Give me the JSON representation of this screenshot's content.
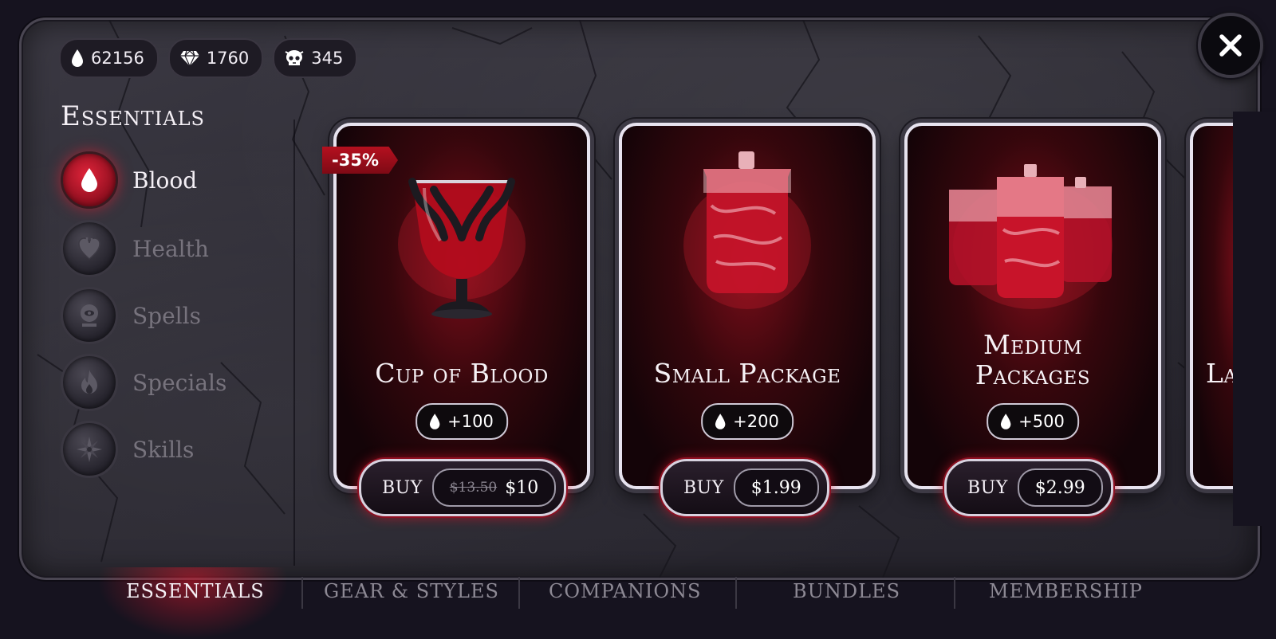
{
  "currency": [
    {
      "icon": "blood-drop-icon",
      "value": "62156"
    },
    {
      "icon": "diamond-icon",
      "value": "1760"
    },
    {
      "icon": "skull-icon",
      "value": "345"
    }
  ],
  "sidebar": {
    "title": "Essentials",
    "items": [
      {
        "label": "Blood",
        "icon": "blood-drop-icon",
        "active": true
      },
      {
        "label": "Health",
        "icon": "heart-icon",
        "active": false
      },
      {
        "label": "Spells",
        "icon": "crystal-ball-icon",
        "active": false
      },
      {
        "label": "Specials",
        "icon": "flame-icon",
        "active": false
      },
      {
        "label": "Skills",
        "icon": "compass-star-icon",
        "active": false
      }
    ]
  },
  "products": [
    {
      "title": "Cup of Blood",
      "reward": "+100",
      "buy_label": "BUY",
      "old_price": "$13.50",
      "price": "$10",
      "badge": "-35%"
    },
    {
      "title": "Small Package",
      "reward": "+200",
      "buy_label": "BUY",
      "price": "$1.99"
    },
    {
      "title_line1": "Medium",
      "title_line2": "Packages",
      "reward": "+500",
      "buy_label": "BUY",
      "price": "$2.99"
    },
    {
      "title": "La"
    }
  ],
  "tabs": [
    {
      "label": "ESSENTIALS",
      "active": true
    },
    {
      "label": "GEAR & STYLES",
      "active": false
    },
    {
      "label": "COMPANIONS",
      "active": false
    },
    {
      "label": "BUNDLES",
      "active": false
    },
    {
      "label": "MEMBERSHIP",
      "active": false
    }
  ],
  "colors": {
    "accent": "#c8142a",
    "background": "#16131f",
    "panel": "#2d2b34"
  }
}
